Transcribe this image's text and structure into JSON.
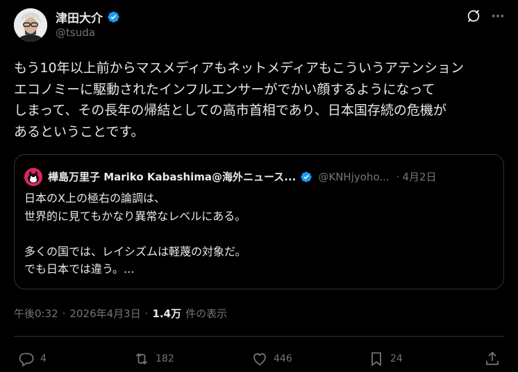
{
  "author": {
    "display_name": "津田大介",
    "handle": "@tsuda"
  },
  "tweet": {
    "text": "もう10年以上前からマスメディアもネットメディアもこういうアテンション\nエコノミーに駆動されたインフルエンサーがでかい顔するようになって\nしまって、その長年の帰結としての高市首相であり、日本国存続の危機が\nあるということです。"
  },
  "quote": {
    "display_name": "樺島万里子 Mariko Kabashima@海外ニュース...",
    "handle": "@KNHjyoho...",
    "date": "4月2日",
    "text": "日本のX上の極右の論調は、\n世界的に見てもかなり異常なレベルにある。\n\n多くの国では、レイシズムは軽蔑の対象だ。\nでも日本では違う。..."
  },
  "meta": {
    "time": "午後0:32",
    "date": "2026年4月3日",
    "views_count": "1.4万",
    "views_label": "件の表示"
  },
  "actions": {
    "replies": "4",
    "reposts": "182",
    "likes": "446",
    "bookmarks": "24"
  },
  "icons": [
    "verified-badge-icon",
    "grok-icon",
    "more-icon",
    "reply-icon",
    "repost-icon",
    "like-icon",
    "bookmark-icon",
    "share-icon"
  ],
  "colors": {
    "background": "#000000",
    "text": "#e7e9ea",
    "muted": "#71767b",
    "verified": "#1d9bf0",
    "border": "#2f3336"
  }
}
